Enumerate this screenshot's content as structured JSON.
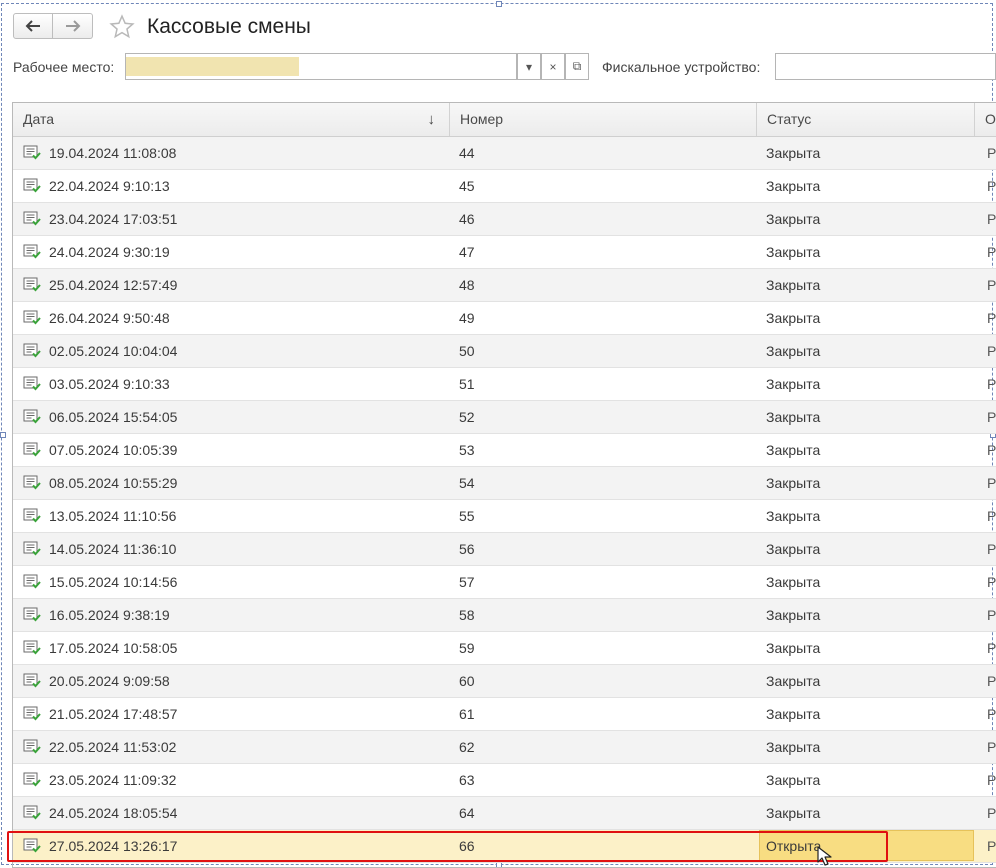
{
  "header": {
    "title": "Кассовые смены",
    "back_icon": "arrow-left-icon",
    "forward_icon": "arrow-right-icon",
    "favorite_icon": "star-icon"
  },
  "filters": {
    "workplace_label": "Рабочее место:",
    "workplace_value": "",
    "fiscal_label": "Фискальное устройство:",
    "fiscal_value": "",
    "dropdown_glyph": "▾",
    "clear_glyph": "×",
    "open_glyph": "⧉"
  },
  "table": {
    "columns": [
      "Дата",
      "Номер",
      "Статус",
      "О"
    ],
    "sort_glyph": "↓",
    "rows": [
      {
        "date": "19.04.2024 11:08:08",
        "number": "44",
        "status": "Закрыта",
        "extra": "Р"
      },
      {
        "date": "22.04.2024 9:10:13",
        "number": "45",
        "status": "Закрыта",
        "extra": "Р"
      },
      {
        "date": "23.04.2024 17:03:51",
        "number": "46",
        "status": "Закрыта",
        "extra": "Р"
      },
      {
        "date": "24.04.2024 9:30:19",
        "number": "47",
        "status": "Закрыта",
        "extra": "Р"
      },
      {
        "date": "25.04.2024 12:57:49",
        "number": "48",
        "status": "Закрыта",
        "extra": "Р"
      },
      {
        "date": "26.04.2024 9:50:48",
        "number": "49",
        "status": "Закрыта",
        "extra": "Р"
      },
      {
        "date": "02.05.2024 10:04:04",
        "number": "50",
        "status": "Закрыта",
        "extra": "Р"
      },
      {
        "date": "03.05.2024 9:10:33",
        "number": "51",
        "status": "Закрыта",
        "extra": "Р"
      },
      {
        "date": "06.05.2024 15:54:05",
        "number": "52",
        "status": "Закрыта",
        "extra": "Р"
      },
      {
        "date": "07.05.2024 10:05:39",
        "number": "53",
        "status": "Закрыта",
        "extra": "Р"
      },
      {
        "date": "08.05.2024 10:55:29",
        "number": "54",
        "status": "Закрыта",
        "extra": "Р"
      },
      {
        "date": "13.05.2024 11:10:56",
        "number": "55",
        "status": "Закрыта",
        "extra": "Р"
      },
      {
        "date": "14.05.2024 11:36:10",
        "number": "56",
        "status": "Закрыта",
        "extra": "Р"
      },
      {
        "date": "15.05.2024 10:14:56",
        "number": "57",
        "status": "Закрыта",
        "extra": "Р"
      },
      {
        "date": "16.05.2024 9:38:19",
        "number": "58",
        "status": "Закрыта",
        "extra": "Р"
      },
      {
        "date": "17.05.2024 10:58:05",
        "number": "59",
        "status": "Закрыта",
        "extra": "Р"
      },
      {
        "date": "20.05.2024 9:09:58",
        "number": "60",
        "status": "Закрыта",
        "extra": "Р"
      },
      {
        "date": "21.05.2024 17:48:57",
        "number": "61",
        "status": "Закрыта",
        "extra": "Р"
      },
      {
        "date": "22.05.2024 11:53:02",
        "number": "62",
        "status": "Закрыта",
        "extra": "Р"
      },
      {
        "date": "23.05.2024 11:09:32",
        "number": "63",
        "status": "Закрыта",
        "extra": "Р"
      },
      {
        "date": "24.05.2024 18:05:54",
        "number": "64",
        "status": "Закрыта",
        "extra": "Р"
      },
      {
        "date": "27.05.2024 13:26:17",
        "number": "66",
        "status": "Открыта",
        "extra": "Р",
        "selected": true
      }
    ]
  },
  "colors": {
    "selected_row": "#fcf1c8",
    "selected_status": "#f8dd82",
    "highlight_box": "#e01010",
    "doc_icon_green": "#3aa33a"
  }
}
